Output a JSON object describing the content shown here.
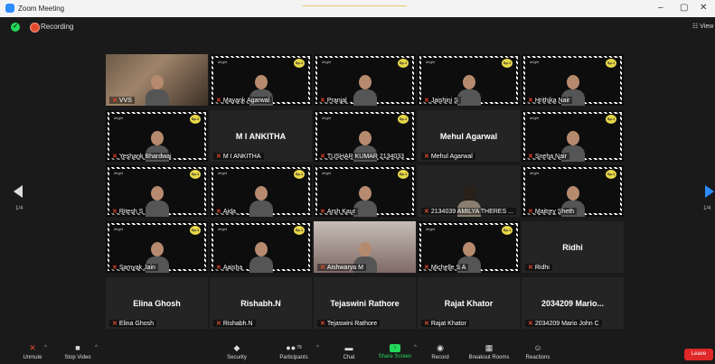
{
  "window": {
    "title": "Zoom Meeting",
    "min": "–",
    "max": "▢",
    "close": "✕"
  },
  "topbar": {
    "recording_label": "Recording",
    "view_label": "View"
  },
  "pager": {
    "left": "1/4",
    "right": "1/4"
  },
  "tiles": [
    {
      "name": "VVS",
      "kind": "video"
    },
    {
      "name": "Mayank Agarwal",
      "kind": "dark",
      "tag": "dright",
      "badge": "Sp.1"
    },
    {
      "name": "Pranjal",
      "kind": "dark",
      "tag": "dright",
      "badge": "Sp.1"
    },
    {
      "name": "Jaishini S",
      "kind": "dark",
      "tag": "dright",
      "badge": "Sp.1"
    },
    {
      "name": "Hrithika Nair",
      "kind": "dark",
      "tag": "dright",
      "badge": "Sp.1"
    },
    {
      "name": "Yeshank Bhardwaj",
      "kind": "dark",
      "tag": "dright",
      "badge": "Sp.1"
    },
    {
      "name": "M I ANKITHA",
      "kind": "card",
      "card_text": "M I ANKITHA"
    },
    {
      "name": "TUSHAR KUMAR 2134033",
      "kind": "dark",
      "tag": "dright",
      "badge": "Sp.1"
    },
    {
      "name": "Mehul Agarwal",
      "kind": "card",
      "card_text": "Mehul Agarwal"
    },
    {
      "name": "Sneha Nair",
      "kind": "dark",
      "tag": "dright",
      "badge": "Sp.1"
    },
    {
      "name": "Ritesh S",
      "kind": "dark",
      "tag": "dright",
      "badge": "Sp.1"
    },
    {
      "name": "Aida",
      "kind": "dark",
      "tag": "dright",
      "badge": "Sp.1"
    },
    {
      "name": "Arsh Kaur",
      "kind": "dark",
      "tag": "dright",
      "badge": "Sp.1"
    },
    {
      "name": "2134039 AMILYA THERES ...",
      "kind": "cardv"
    },
    {
      "name": "Maitrey Sheth",
      "kind": "dark",
      "tag": "dright",
      "badge": "Sp.1"
    },
    {
      "name": "Samyak Jain",
      "kind": "dark",
      "tag": "dright",
      "badge": "Sp.1"
    },
    {
      "name": "Aaisha",
      "kind": "dark",
      "tag": "dright",
      "badge": "Sp.1"
    },
    {
      "name": "Aishwarya M",
      "kind": "light"
    },
    {
      "name": "Michelle S A",
      "kind": "dark",
      "tag": "dright",
      "badge": "Sp.1"
    },
    {
      "name": "Ridhi",
      "kind": "card",
      "card_text": "Ridhi"
    },
    {
      "name": "Elina Ghosh",
      "kind": "card",
      "card_text": "Elina Ghosh"
    },
    {
      "name": "Rishabh.N",
      "kind": "card",
      "card_text": "Rishabh.N"
    },
    {
      "name": "Tejaswini Rathore",
      "kind": "card",
      "card_text": "Tejaswini Rathore"
    },
    {
      "name": "Rajat Khator",
      "kind": "card",
      "card_text": "Rajat Khator"
    },
    {
      "name": "2034209 Mario John C",
      "kind": "card",
      "card_text": "2034209 Mario..."
    }
  ],
  "toolbar": {
    "unmute": "Unmute",
    "stop_video": "Stop Video",
    "security": "Security",
    "participants": "Participants",
    "participants_count": "79",
    "chat": "Chat",
    "share_screen": "Share Screen",
    "record": "Record",
    "breakout_rooms": "Breakout Rooms",
    "reactions": "Reactions",
    "leave": "Leave"
  },
  "icons": {
    "shield": "shield-icon",
    "mic_muted": "mic-muted-icon",
    "camera": "camera-icon",
    "people": "people-icon",
    "chat": "chat-bubble-icon",
    "share": "share-arrow-icon",
    "record": "record-icon",
    "grid": "grid-icon",
    "smile": "smile-plus-icon"
  },
  "colors": {
    "zoom_blue": "#2d8cff",
    "share_green": "#23d959",
    "leave_red": "#e02828",
    "recording_red": "#e34a2c",
    "active_speaker": "#e0e05a"
  }
}
